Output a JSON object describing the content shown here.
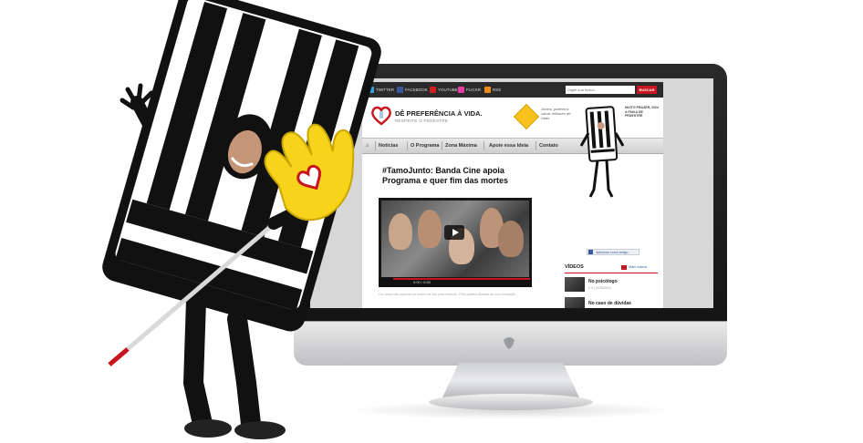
{
  "social_links": [
    {
      "label": "TWITTER",
      "color": "#3aa0e0"
    },
    {
      "label": "FACEBOOK",
      "color": "#3b5998"
    },
    {
      "label": "YOUTUBE",
      "color": "#d02020"
    },
    {
      "label": "FLICKR",
      "color": "#e43fa0"
    },
    {
      "label": "RSS",
      "color": "#f08a1c"
    }
  ],
  "search": {
    "placeholder": "Digite sua busca...",
    "button_label": "BUSCAR"
  },
  "brand": {
    "title": "DÊ PREFERÊNCIA À VIDA.",
    "subtitle": "RESPEITE O PEDESTRE",
    "tagline": "Juntos, podemos salvar milhares de vidas"
  },
  "nav": {
    "items": [
      "Notícias",
      "O Programa",
      "Zona Máxima",
      "Apoie essa Ideia",
      "Contato"
    ]
  },
  "post": {
    "title": "#TamoJunto: Banda Cine apoia Programa e quer fim das mortes",
    "video_time": "0:00 / 0:53",
    "caption": "Os caras não apenas se unem na luta pelo trânsito. Pela quarta década de sua formação..."
  },
  "sidebar": {
    "mascot_text": "MUITO PRAZER, SOU A FAIXA DE PEDESTRE",
    "fb_button": "Adicionar como amigo",
    "videos_heading": "VÍDEOS",
    "more_videos": "Mais vídeos",
    "videos": [
      {
        "title": "No psicólogo",
        "meta": "0 // | 21/06/2011"
      },
      {
        "title": "No caso de dúvidas",
        "meta": ""
      }
    ]
  },
  "colors": {
    "accent": "#c8141e",
    "dark_bar": "#2b2b2b",
    "hand": "#f7d31b"
  }
}
